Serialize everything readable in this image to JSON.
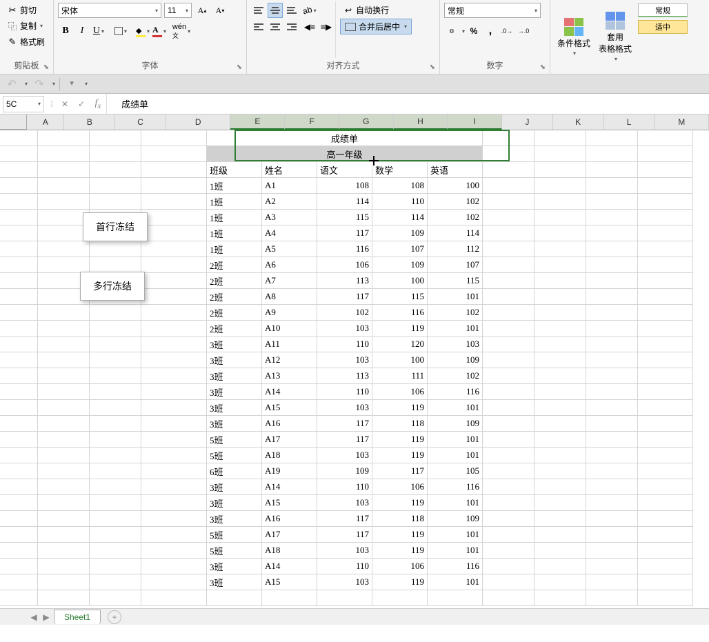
{
  "clipboard": {
    "cut": "剪切",
    "copy": "复制",
    "paint": "格式刷",
    "group": "剪貼板"
  },
  "font": {
    "name": "宋体",
    "size": "11",
    "group": "字体",
    "bold": "B",
    "italic": "I",
    "underline": "U"
  },
  "alignment": {
    "wrap": "自动换行",
    "merge": "合并后居中",
    "group": "对齐方式"
  },
  "number": {
    "format": "常规",
    "group": "数字"
  },
  "styles": {
    "cond": "条件格式",
    "table": "套用\n表格格式",
    "normal": "常规",
    "good": "适中"
  },
  "formula_bar": {
    "name_box": "5C",
    "fx_value": "成绩单"
  },
  "columns": [
    "A",
    "B",
    "C",
    "D",
    "E",
    "F",
    "G",
    "H",
    "I",
    "J",
    "K",
    "L",
    "M"
  ],
  "selected_cols": [
    "E",
    "F",
    "G",
    "H",
    "I"
  ],
  "title_cell": "成绩单",
  "subtitle_cell": "高一年级",
  "headers": [
    "班级",
    "姓名",
    "语文",
    "数学",
    "英语"
  ],
  "rows": [
    [
      "1班",
      "A1",
      108,
      108,
      100
    ],
    [
      "1班",
      "A2",
      114,
      110,
      102
    ],
    [
      "1班",
      "A3",
      115,
      114,
      102
    ],
    [
      "1班",
      "A4",
      117,
      109,
      114
    ],
    [
      "1班",
      "A5",
      116,
      107,
      112
    ],
    [
      "2班",
      "A6",
      106,
      109,
      107
    ],
    [
      "2班",
      "A7",
      113,
      100,
      115
    ],
    [
      "2班",
      "A8",
      117,
      115,
      101
    ],
    [
      "2班",
      "A9",
      102,
      116,
      102
    ],
    [
      "2班",
      "A10",
      103,
      119,
      101
    ],
    [
      "3班",
      "A11",
      110,
      120,
      103
    ],
    [
      "3班",
      "A12",
      103,
      100,
      109
    ],
    [
      "3班",
      "A13",
      113,
      111,
      102
    ],
    [
      "3班",
      "A14",
      110,
      106,
      116
    ],
    [
      "3班",
      "A15",
      103,
      119,
      101
    ],
    [
      "3班",
      "A16",
      117,
      118,
      109
    ],
    [
      "5班",
      "A17",
      117,
      119,
      101
    ],
    [
      "5班",
      "A18",
      103,
      119,
      101
    ],
    [
      "6班",
      "A19",
      109,
      117,
      105
    ],
    [
      "3班",
      "A14",
      110,
      106,
      116
    ],
    [
      "3班",
      "A15",
      103,
      119,
      101
    ],
    [
      "3班",
      "A16",
      117,
      118,
      109
    ],
    [
      "5班",
      "A17",
      117,
      119,
      101
    ],
    [
      "5班",
      "A18",
      103,
      119,
      101
    ],
    [
      "3班",
      "A14",
      110,
      106,
      116
    ],
    [
      "3班",
      "A15",
      103,
      119,
      101
    ]
  ],
  "callouts": {
    "freeze_first": "首行冻结",
    "freeze_multi": "多行冻结"
  },
  "sheet_tab": "Sheet1"
}
